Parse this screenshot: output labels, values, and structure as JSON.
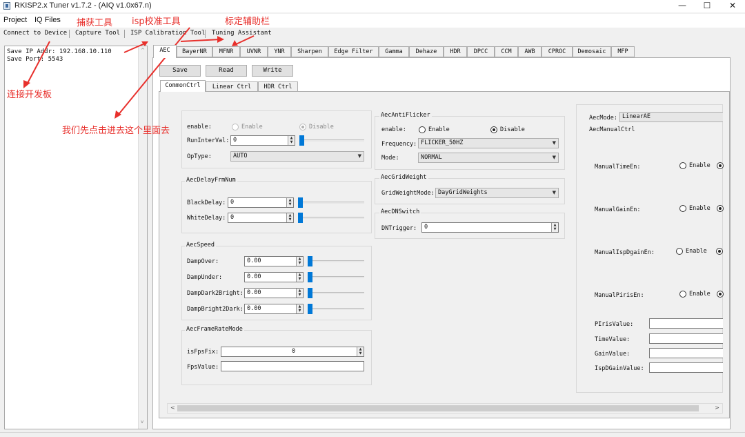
{
  "window": {
    "title": "RKISP2.x Tuner v1.7.2 - (AIQ v1.0x67.n)",
    "minimize": "—",
    "maximize": "☐",
    "close": "✕"
  },
  "menu": [
    "Project",
    "IQ Files"
  ],
  "toolbar": [
    "Connect to Device",
    "Capture Tool",
    "ISP Calibration Tool",
    "Tuning Assistant"
  ],
  "annotations": {
    "capture": "捕获工具",
    "isp": "isp校准工具",
    "assist": "标定辅助栏",
    "connect": "连接开发板",
    "click": "我们先点击进去这个里面去"
  },
  "left_panel": {
    "line1": "Save IP Addr: 192.168.10.110",
    "line2": "Save Port: 5543"
  },
  "tabs": [
    "AEC",
    "BayerNR",
    "MFNR",
    "UVNR",
    "YNR",
    "Sharpen",
    "Edge Filter",
    "Gamma",
    "Dehaze",
    "HDR",
    "DPCC",
    "CCM",
    "AWB",
    "CPROC",
    "Demosaic",
    "MFP"
  ],
  "buttons": {
    "save": "Save",
    "read": "Read",
    "write": "Write"
  },
  "subtabs": [
    "CommonCtrl",
    "Linear Ctrl",
    "HDR Ctrl"
  ],
  "icons": {
    "spin_up": "▲",
    "spin_down": "▼",
    "combo_caret": "▼",
    "left_arrow": "<",
    "right_arrow": ">",
    "up_arrow": "^",
    "down_arrow": "v"
  },
  "general": {
    "enable_label": "enable:",
    "enable_opt": "Enable",
    "disable_opt": "Disable",
    "runinterval_label": "RunInterVal:",
    "runinterval_value": "0",
    "optype_label": "OpType:",
    "optype_value": "AUTO"
  },
  "delay": {
    "title": "AecDelayFrmNum",
    "black_label": "BlackDelay:",
    "black_value": "0",
    "white_label": "WhiteDelay:",
    "white_value": "0"
  },
  "speed": {
    "title": "AecSpeed",
    "rows": [
      {
        "label": "DampOver:",
        "value": "0.00"
      },
      {
        "label": "DampUnder:",
        "value": "0.00"
      },
      {
        "label": "DampDark2Bright:",
        "value": "0.00"
      },
      {
        "label": "DampBright2Dark:",
        "value": "0.00"
      }
    ]
  },
  "framerate": {
    "title": "AecFrameRateMode",
    "isfpsfix_label": "isFpsFix:",
    "isfpsfix_value": "0",
    "fpsvalue_label": "FpsValue:",
    "fpsvalue_value": ""
  },
  "antiflicker": {
    "title": "AecAntiFlicker",
    "enable_label": "enable:",
    "enable_opt": "Enable",
    "disable_opt": "Disable",
    "freq_label": "Frequency:",
    "freq_value": "FLICKER_50HZ",
    "mode_label": "Mode:",
    "mode_value": "NORMAL"
  },
  "gridweight": {
    "title": "AecGridWeight",
    "label": "GridWeightMode:",
    "value": "DayGridWeights"
  },
  "dnswitch": {
    "title": "AecDNSwitch",
    "label": "DNTrigger:",
    "value": "0"
  },
  "manual": {
    "mode_label": "AecMode:",
    "mode_value": "LinearAE",
    "title": "AecManualCtrl",
    "enables": [
      {
        "label": "ManualTimeEn:",
        "opt": "Enable"
      },
      {
        "label": "ManualGainEn:",
        "opt": "Enable"
      },
      {
        "label": "ManualIspDgainEn:",
        "opt": "Enable"
      },
      {
        "label": "ManualPirisEn:",
        "opt": "Enable"
      }
    ],
    "values": [
      {
        "label": "PIrisValue:",
        "value": ""
      },
      {
        "label": "TimeValue:",
        "value": ""
      },
      {
        "label": "GainValue:",
        "value": ""
      },
      {
        "label": "IspDGainValue:",
        "value": ""
      }
    ]
  }
}
